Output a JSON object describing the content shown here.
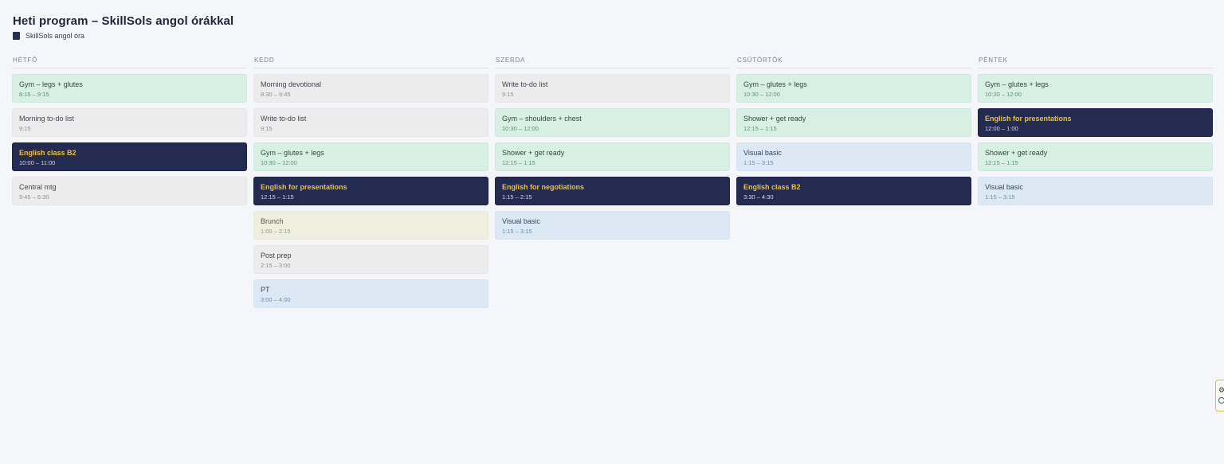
{
  "header": {
    "title": "Heti program – SkillSols angol órákkal",
    "legend_label": "SkillSols angol óra",
    "legend_color": "#262e52"
  },
  "days": [
    {
      "label": "HÉTFŐ",
      "events": [
        {
          "name": "Gym – legs + glutes",
          "time": "8:15 – 9:15",
          "color": "green"
        },
        {
          "name": "Morning to-do list",
          "time": "9:15",
          "color": "gray"
        },
        {
          "name": "English class B2",
          "time": "10:00 – 11:00",
          "color": "navy"
        },
        {
          "name": "Central mtg",
          "time": "9:45 – 6:30",
          "color": "gray"
        }
      ]
    },
    {
      "label": "KEDD",
      "events": [
        {
          "name": "Morning devotional",
          "time": "8:30 – 9:45",
          "color": "gray"
        },
        {
          "name": "Write to-do list",
          "time": "9:15",
          "color": "gray"
        },
        {
          "name": "Gym – glutes + legs",
          "time": "10:30 – 12:00",
          "color": "green"
        },
        {
          "name": "English for presentations",
          "time": "12:15 – 1:15",
          "color": "navy"
        },
        {
          "name": "Brunch",
          "time": "1:00 – 2:15",
          "color": "beige"
        },
        {
          "name": "Post prep",
          "time": "2:15 – 3:00",
          "color": "gray"
        },
        {
          "name": "PT",
          "time": "3:00 – 4:00",
          "color": "blue"
        }
      ]
    },
    {
      "label": "SZERDA",
      "events": [
        {
          "name": "Write to-do list",
          "time": "9:15",
          "color": "gray"
        },
        {
          "name": "Gym – shoulders + chest",
          "time": "10:30 – 12:00",
          "color": "green"
        },
        {
          "name": "Shower + get ready",
          "time": "12:15 – 1:15",
          "color": "green"
        },
        {
          "name": "English for negotiations",
          "time": "1:15 – 2:15",
          "color": "navy"
        },
        {
          "name": "Visual basic",
          "time": "1:15 – 3:15",
          "color": "blue"
        }
      ]
    },
    {
      "label": "CSÜTÖRTÖK",
      "events": [
        {
          "name": "Gym – glutes + legs",
          "time": "10:30 – 12:00",
          "color": "green"
        },
        {
          "name": "Shower + get ready",
          "time": "12:15 – 1:15",
          "color": "green"
        },
        {
          "name": "Visual basic",
          "time": "1:15 – 3:15",
          "color": "blue"
        },
        {
          "name": "English class B2",
          "time": "3:30 – 4:30",
          "color": "navy"
        }
      ]
    },
    {
      "label": "PÉNTEK",
      "events": [
        {
          "name": "Gym – glutes + legs",
          "time": "10:30 – 12:00",
          "color": "green"
        },
        {
          "name": "English for presentations",
          "time": "12:00 – 1:00",
          "color": "navy"
        },
        {
          "name": "Shower + get ready",
          "time": "12:15 – 1:15",
          "color": "green"
        },
        {
          "name": "Visual basic",
          "time": "1:15 – 3:15",
          "color": "blue"
        }
      ]
    }
  ],
  "colors": {
    "green": "#d8efe4",
    "gray": "#ececec",
    "blue": "#dce9f5",
    "beige": "#eeefdf",
    "navy": "#232b50",
    "navy_text": "#f2c128"
  },
  "widget": {
    "icon_top": "gear-icon",
    "icon_bottom": "circle-icon"
  }
}
